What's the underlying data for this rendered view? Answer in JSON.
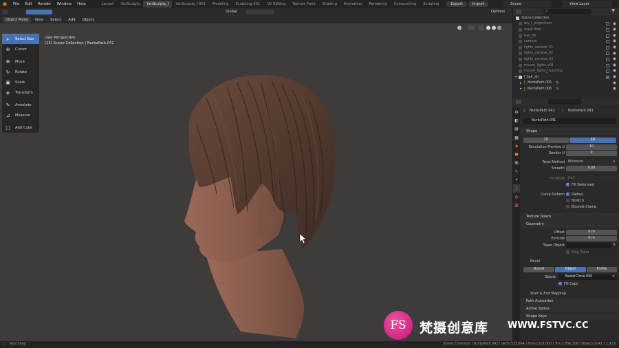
{
  "menubar": {
    "items": [
      "File",
      "Edit",
      "Render",
      "Window",
      "Help"
    ],
    "workspaces": [
      "Layout",
      "YanSculpts",
      "YanSculpts_f",
      "YanSculpts_f.001",
      "Modeling",
      "Sculpting.001",
      "UV Editing",
      "Texture Paint",
      "Shading",
      "Animation",
      "Rendering",
      "Compositing",
      "Scripting"
    ],
    "active_workspace": "YanSculpts_f",
    "export_label": "Export",
    "import_label": "Import",
    "scene": "Scene",
    "view_layer": "View Layer"
  },
  "viewport": {
    "transform_orientation": "Global",
    "options_label": "Options",
    "mode": "Object Mode",
    "menus": [
      "View",
      "Select",
      "Add",
      "Object"
    ],
    "perspective": "User Perspective",
    "collection_path": "(15) Scene Collection | NurbsPath.041",
    "tools": [
      {
        "label": "Select Box",
        "icon": "select-box-icon",
        "glyph": "▸"
      },
      {
        "label": "Cursor",
        "icon": "cursor-icon",
        "glyph": "⊕"
      },
      {
        "label": "Move",
        "icon": "move-icon",
        "glyph": "✥"
      },
      {
        "label": "Rotate",
        "icon": "rotate-icon",
        "glyph": "↻"
      },
      {
        "label": "Scale",
        "icon": "scale-icon",
        "glyph": "▣"
      },
      {
        "label": "Transform",
        "icon": "transform-icon",
        "glyph": "◈"
      },
      {
        "label": "Annotate",
        "icon": "annotate-icon",
        "glyph": "✎"
      },
      {
        "label": "Measure",
        "icon": "measure-icon",
        "glyph": "⊿"
      },
      {
        "label": "Add Cube",
        "icon": "add-cube-icon",
        "glyph": "▢"
      }
    ]
  },
  "outliner": {
    "root": "Scene Collection",
    "items": [
      "dry_f_projections",
      "mask floor",
      "hair_str",
      "camera",
      "lights_camera_01",
      "lights_camera_02",
      "lights_camera_03",
      "mouse_lights_v01",
      "mouse_lights_trunchng"
    ],
    "group": "f_hair_str",
    "children": [
      "NurbsPath.005",
      "NurbsPath.006"
    ]
  },
  "properties": {
    "object_name": "NurbsPath.041",
    "data_name": "NurbsPath.041",
    "datablock": "NurbsPath.041",
    "shape_header": "Shape",
    "dim_2d": "2D",
    "dim_3d": "3D",
    "resolution_preview_label": "Resolution Preview U",
    "resolution_preview_value": "10",
    "render_label": "Render U",
    "render_value": "0",
    "twist_method_label": "Twist Method",
    "twist_method_value": "Minimum",
    "smooth_label": "Smooth",
    "smooth_value": "0.00",
    "fill_mode_label": "Fill Mode",
    "fill_mode_value": "Half",
    "fill_deformed_label": "Fill Deformed",
    "curve_deform_label": "Curve Deform",
    "radius_label": "Radius",
    "stretch_label": "Stretch",
    "bounds_clamp_label": "Bounds Clamp",
    "texture_space_header": "Texture Space",
    "geometry_header": "Geometry",
    "offset_label": "Offset",
    "offset_value": "0 m",
    "extrude_label": "Extrude",
    "extrude_value": "0 m",
    "taper_object_label": "Taper Object",
    "map_taper_label": "Map Taper",
    "bevel_header": "Bevel",
    "bevel_round": "Round",
    "bevel_object": "Object",
    "bevel_profile": "Profile",
    "object_label": "Object",
    "object_value": "BezierCircle.006",
    "fill_caps_label": "Fill Caps",
    "start_end_header": "Start & End Mapping",
    "path_animation_header": "Path Animation",
    "active_spline_header": "Active Spline",
    "shape_keys_header": "Shape Keys"
  },
  "statusbar": {
    "left": "Axis Snap",
    "right": "Scene Collection | NurbsPath.041 | Verts:533,664 | Faces:528,000 | Tris:1,056,208 | Objects:0/41 | 2.92.0"
  },
  "watermark": {
    "badge": "FS",
    "chinese": "梵摄创意库",
    "url": "WWW.FSTVC.CC"
  },
  "colors": {
    "accent": "#4772b3",
    "viewport_bg": "#3e3b3a",
    "hair": "#5a4034",
    "skin": "#8a5b4b"
  }
}
